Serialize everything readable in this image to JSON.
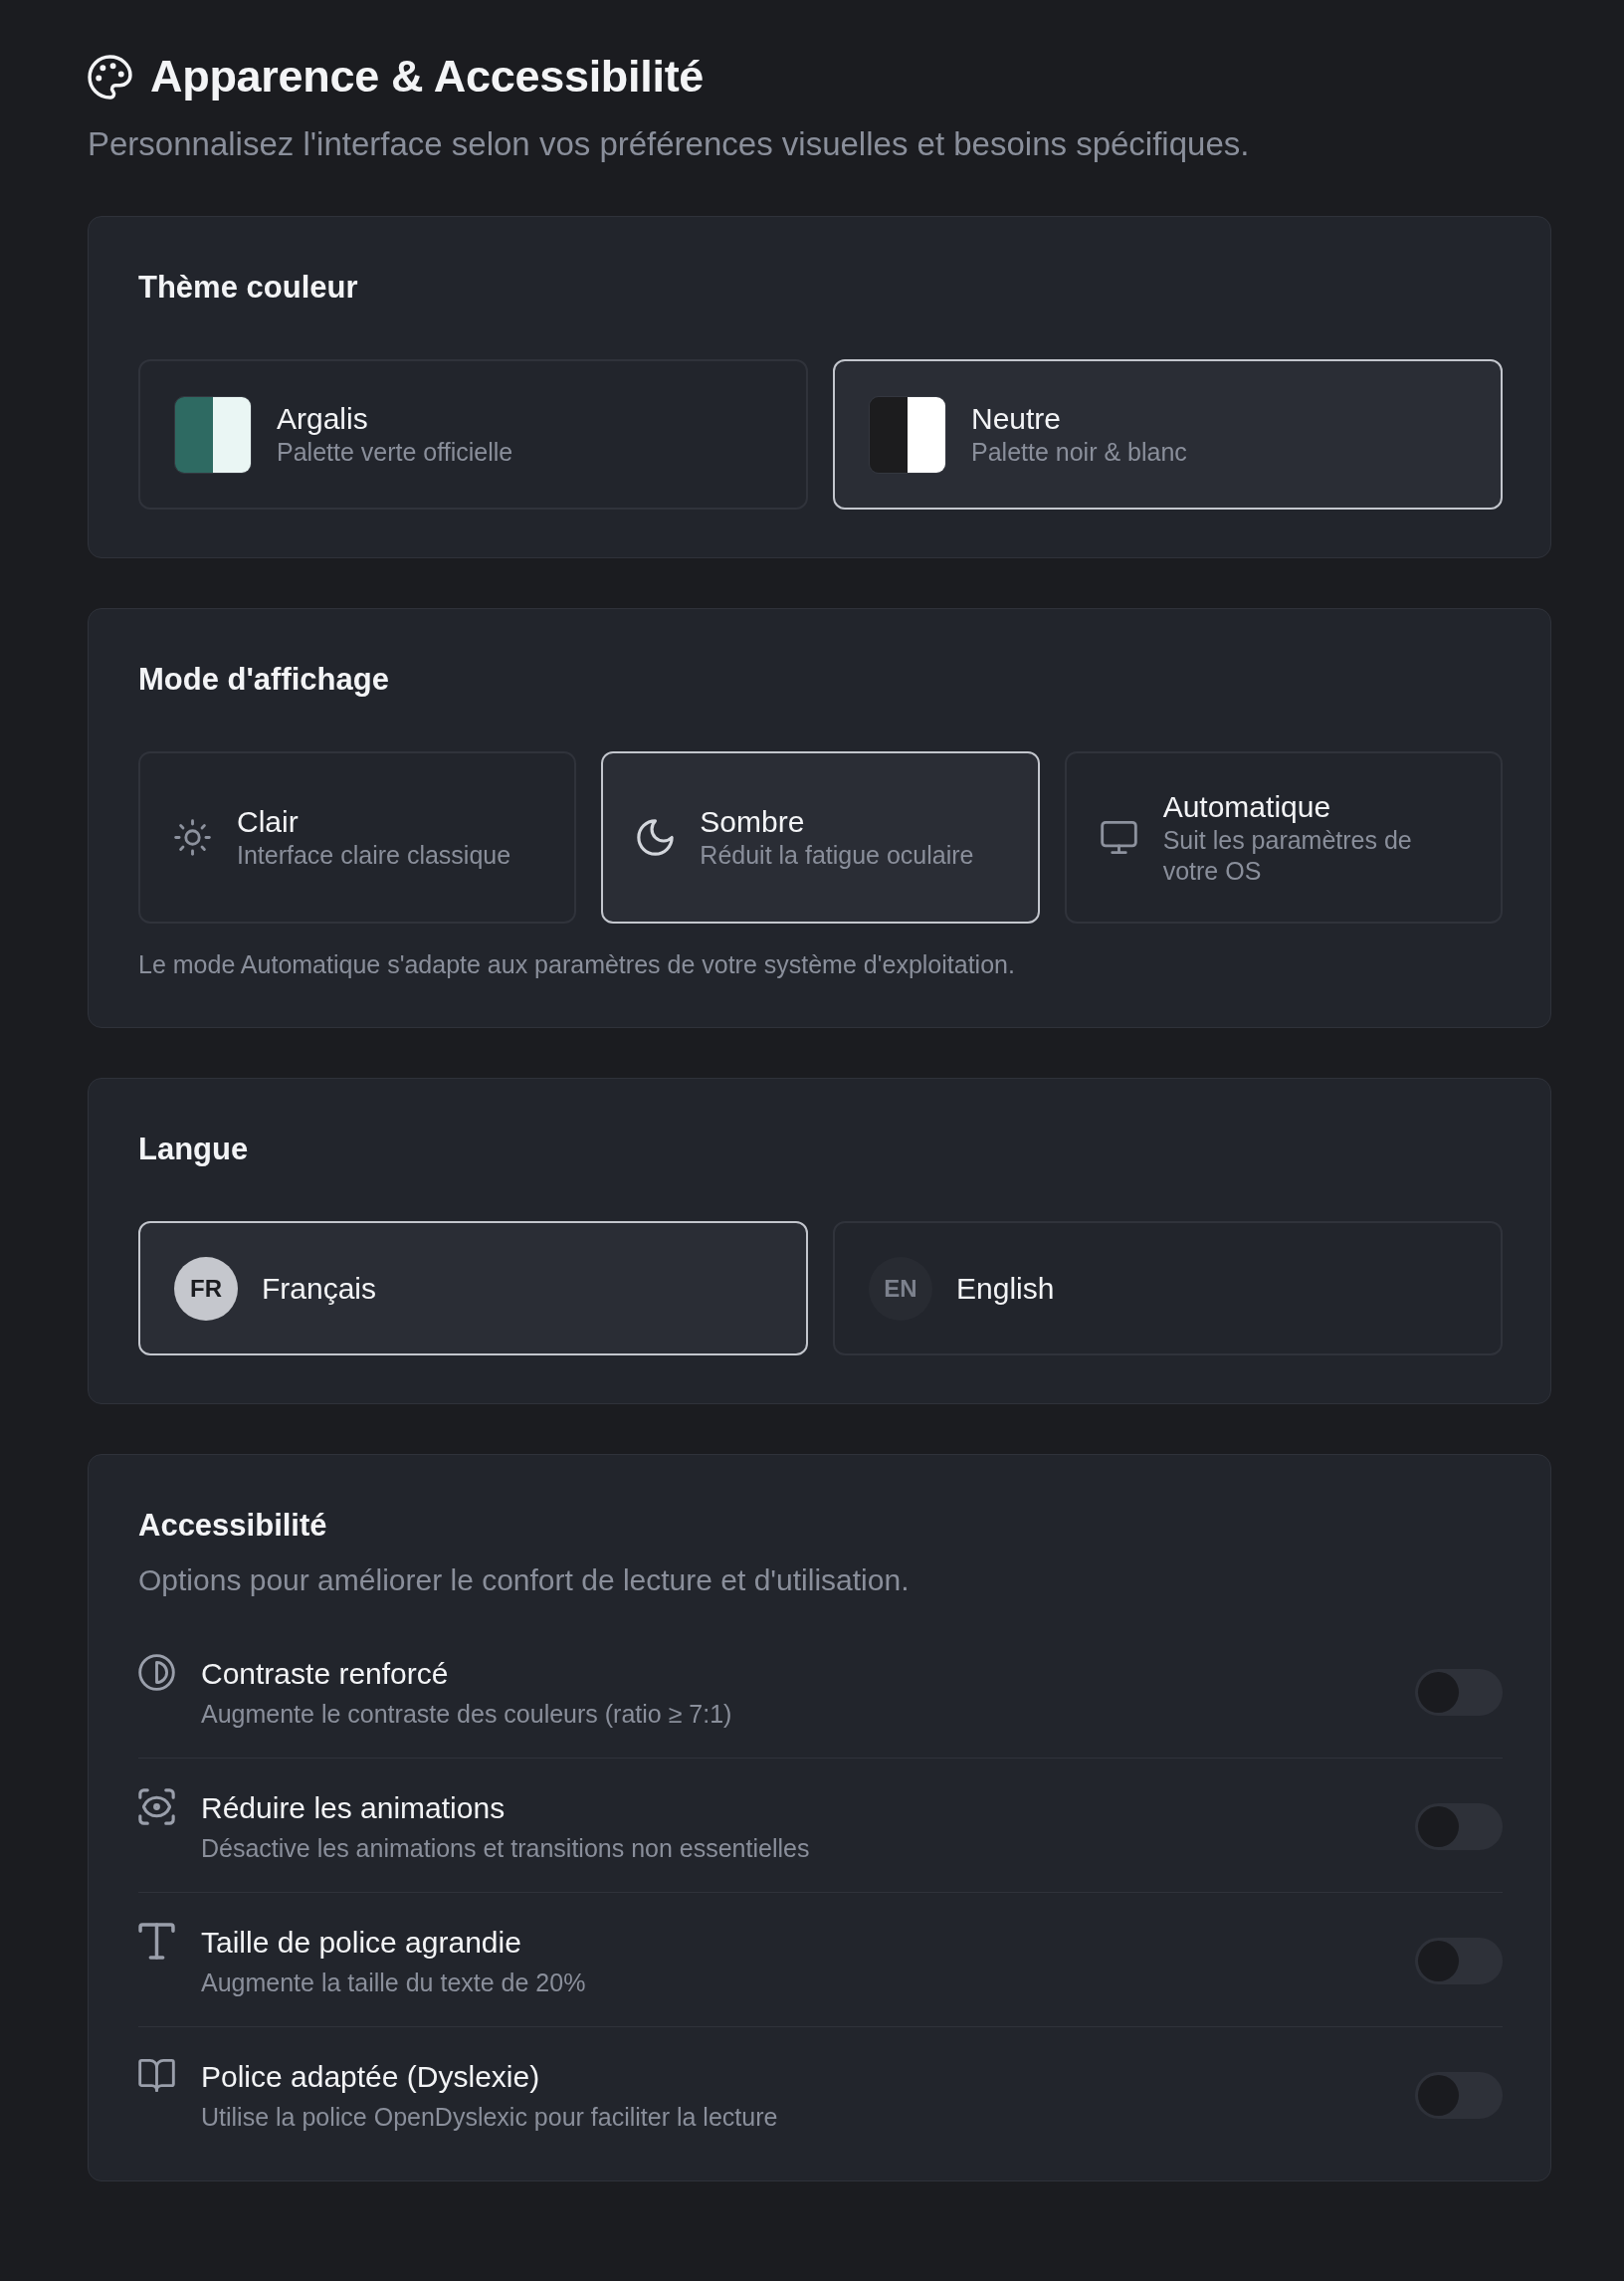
{
  "header": {
    "title": "Apparence & Accessibilité",
    "subtitle": "Personnalisez l'interface selon vos préférences visuelles et besoins spécifiques."
  },
  "theme": {
    "title": "Thème couleur",
    "options": [
      {
        "name": "Argalis",
        "description": "Palette verte officielle",
        "swatch": [
          {
            "color": "#2e6a62"
          },
          {
            "color": "#eaf6f4"
          }
        ],
        "selected": false
      },
      {
        "name": "Neutre",
        "description": "Palette noir & blanc",
        "swatch": [
          {
            "color": "#1c1c1e"
          },
          {
            "color": "#ffffff"
          }
        ],
        "selected": true
      }
    ]
  },
  "display_mode": {
    "title": "Mode d'affichage",
    "options": [
      {
        "name": "Clair",
        "description": "Interface claire classique",
        "selected": false
      },
      {
        "name": "Sombre",
        "description": "Réduit la fatigue oculaire",
        "selected": true
      },
      {
        "name": "Automatique",
        "description": "Suit les paramètres de votre OS",
        "selected": false
      }
    ],
    "note": "Le mode Automatique s'adapte aux paramètres de votre système d'exploitation."
  },
  "language": {
    "title": "Langue",
    "options": [
      {
        "code": "FR",
        "name": "Français",
        "selected": true
      },
      {
        "code": "EN",
        "name": "English",
        "selected": false
      }
    ]
  },
  "accessibility": {
    "title": "Accessibilité",
    "description": "Options pour améliorer le confort de lecture et d'utilisation.",
    "options": [
      {
        "name": "Contraste renforcé",
        "description": "Augmente le contraste des couleurs (ratio ≥ 7:1)",
        "on": false
      },
      {
        "name": "Réduire les animations",
        "description": "Désactive les animations et transitions non essentielles",
        "on": false
      },
      {
        "name": "Taille de police agrandie",
        "description": "Augmente la taille du texte de 20%",
        "on": false
      },
      {
        "name": "Police adaptée (Dyslexie)",
        "description": "Utilise la police OpenDyslexic pour faciliter la lecture",
        "on": false
      }
    ]
  }
}
